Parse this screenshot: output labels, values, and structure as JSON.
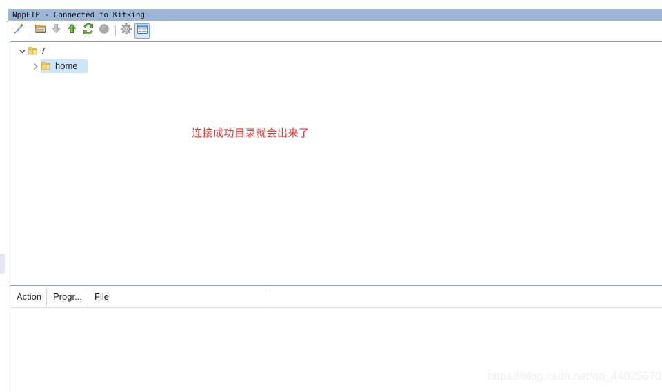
{
  "window": {
    "title": "NppFTP - Connected to Kitking"
  },
  "toolbar": {
    "buttons": [
      {
        "name": "connect-icon",
        "label": "(Dis)connect",
        "state": "enabled",
        "icon": "plug"
      },
      {
        "name": "open-folder-icon",
        "label": "Open directory",
        "state": "enabled",
        "icon": "folder-open"
      },
      {
        "name": "download-icon",
        "label": "Download file",
        "state": "disabled",
        "icon": "arrow-down"
      },
      {
        "name": "upload-icon",
        "label": "Upload file",
        "state": "enabled",
        "icon": "arrow-up"
      },
      {
        "name": "refresh-icon",
        "label": "Refresh",
        "state": "enabled",
        "icon": "refresh"
      },
      {
        "name": "abort-icon",
        "label": "Abort operation",
        "state": "disabled",
        "icon": "abort-circle"
      },
      {
        "name": "settings-icon",
        "label": "Settings",
        "state": "enabled",
        "icon": "gear"
      },
      {
        "name": "messages-icon",
        "label": "Show messages",
        "state": "selected",
        "icon": "message-window"
      }
    ]
  },
  "tree": {
    "nodes": [
      {
        "label": "/",
        "expanded": true,
        "selected": false,
        "indent": 0,
        "icon": "folder-icon"
      },
      {
        "label": "home",
        "expanded": false,
        "selected": true,
        "indent": 1,
        "icon": "folder-icon"
      }
    ]
  },
  "annotation": {
    "text": "连接成功目录就会出来了",
    "color": "#f42c2c"
  },
  "queue": {
    "columns": [
      {
        "label": "Action"
      },
      {
        "label": "Progr..."
      },
      {
        "label": "File"
      }
    ],
    "rows": []
  },
  "watermark": {
    "text": "https://blog.csdn.net/qq_44025670"
  },
  "colors": {
    "titlebar": "#9bb6d6",
    "selection": "#cfe6fa",
    "folder": "#f5c954",
    "accent_red": "#f42c2c",
    "panel_border": "#9aa0aa"
  }
}
